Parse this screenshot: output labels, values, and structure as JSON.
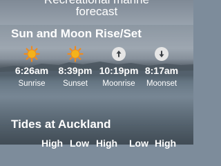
{
  "header": {
    "line1": "Recreational marine",
    "line2": "forecast"
  },
  "sun_moon": {
    "title": "Sun and Moon Rise/Set",
    "items": [
      {
        "icon": "sun-icon",
        "time": "6:26am",
        "label": "Sunrise"
      },
      {
        "icon": "sun-icon",
        "time": "8:39pm",
        "label": "Sunset"
      },
      {
        "icon": "arrow-up-icon",
        "time": "10:19pm",
        "label": "Moonrise"
      },
      {
        "icon": "arrow-down-icon",
        "time": "8:17am",
        "label": "Moonset"
      }
    ]
  },
  "tides": {
    "title": "Tides at Auckland",
    "labels": [
      "High",
      "Low",
      "High",
      "Low",
      "High"
    ]
  },
  "colors": {
    "sun_fill": "#f3b21b",
    "sun_ray": "#f08a1c",
    "moon_badge": "#e6e6e6"
  }
}
